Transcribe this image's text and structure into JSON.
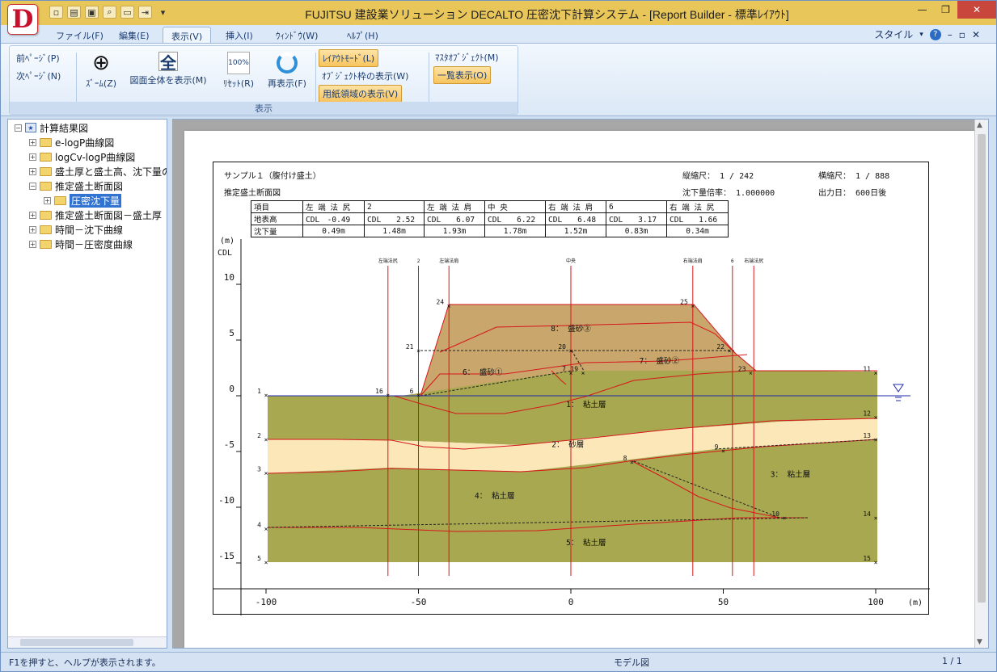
{
  "app": {
    "title": "FUJITSU 建設業ソリューション DECALTO 圧密沈下計算システム - [Report Builder - 標準ﾚｲｱｳﾄ]",
    "logo_letter": "D"
  },
  "quick_access": [
    "new-icon",
    "open-icon",
    "save-icon",
    "print-preview-icon",
    "print-icon",
    "export-icon"
  ],
  "window_controls": {
    "minimize": "—",
    "restore": "❐",
    "close": "✕"
  },
  "ribbon_tabs": [
    {
      "label": "ファイル(F)",
      "active": false
    },
    {
      "label": "編集(E)",
      "active": false
    },
    {
      "label": "表示(V)",
      "active": true
    },
    {
      "label": "挿入(I)",
      "active": false
    },
    {
      "label": "ｳｨﾝﾄﾞｳ(W)",
      "active": false
    },
    {
      "label": "ﾍﾙﾌﾟ(H)",
      "active": false
    }
  ],
  "ribbon_right": {
    "style_label": "スタイル",
    "dropdown": "▾",
    "help": "?",
    "mdi_min": "–",
    "mdi_restore": "▫",
    "mdi_close": "✕"
  },
  "ribbon": {
    "group_label": "表示",
    "prev_page": "前ﾍﾟｰｼﾞ(P)",
    "next_page": "次ﾍﾟｰｼﾞ(N)",
    "zoom": "ｽﾞｰﾑ(Z)",
    "fit_all": "図面全体を表示(M)",
    "fit_all_icon_text": "全",
    "reset": "ﾘｾｯﾄ(R)",
    "reset_icon_text": "100%",
    "redraw": "再表示(F)",
    "layout_mode": "ﾚｲｱｳﾄﾓｰﾄﾞ(L)",
    "object_frame": "ｵﾌﾞｼﾞｪｸﾄ枠の表示(W)",
    "paper_area": "用紙領域の表示(V)",
    "master_object": "ﾏｽﾀｵﾌﾞｼﾞｪｸﾄ(M)",
    "list_view": "一覧表示(O)"
  },
  "tree": {
    "root": "計算結果図",
    "items": [
      {
        "label": "e-logP曲線図",
        "level": 1,
        "expanded": false
      },
      {
        "label": "logCv-logP曲線図",
        "level": 1,
        "expanded": false
      },
      {
        "label": "盛土厚と盛土高、沈下量の",
        "level": 1,
        "expanded": false
      },
      {
        "label": "推定盛土断面図",
        "level": 1,
        "expanded": true
      },
      {
        "label": "圧密沈下量",
        "level": 2,
        "selected": true
      },
      {
        "label": "推定盛土断面図－盛土厚",
        "level": 1,
        "expanded": false
      },
      {
        "label": "時間－沈下曲線",
        "level": 1,
        "expanded": false
      },
      {
        "label": "時間－圧密度曲線",
        "level": 1,
        "expanded": false
      }
    ]
  },
  "report": {
    "title": "サンプル１（腹付け盛土）",
    "subtitle": "推定盛土断面図",
    "v_scale": "縦縮尺： 1 / 242",
    "h_scale": "横縮尺： 1 / 888",
    "settle_factor": "沈下量倍率： 1.000000",
    "output_day": "出力日： 600日後",
    "table_header": [
      "項目",
      "左 端 法 尻",
      "2",
      "左 端 法 肩",
      "中 央",
      "右 端 法 肩",
      "6",
      "右 端 法 尻"
    ],
    "table_row1": [
      "地表高",
      "CDL　-0.49",
      "CDL　　2.52",
      "CDL　　6.07",
      "CDL　　6.22",
      "CDL　　6.48",
      "CDL　　3.17",
      "CDL　　1.66"
    ],
    "table_row2": [
      "沈下量",
      "0.49m",
      "1.48m",
      "1.93m",
      "1.78m",
      "1.52m",
      "0.83m",
      "0.34m"
    ],
    "y_unit": "(m)",
    "y_datum": "CDL",
    "x_unit": "(m)"
  },
  "chart_data": {
    "type": "diagram",
    "x_ticks": [
      -100,
      -50,
      0,
      50,
      100
    ],
    "y_ticks": [
      10,
      5,
      0,
      -5,
      -10,
      -15
    ],
    "section_lines": [
      {
        "x": -60,
        "label": "左端法尻"
      },
      {
        "x": -50,
        "label": "2"
      },
      {
        "x": -40,
        "label": "左端法肩"
      },
      {
        "x": 0,
        "label": "中央"
      },
      {
        "x": 40,
        "label": "右端法肩"
      },
      {
        "x": 53,
        "label": "6"
      },
      {
        "x": 60,
        "label": "右端法尻"
      }
    ],
    "layer_labels": [
      {
        "label": "1： 粘土層",
        "x": 5,
        "y": -1
      },
      {
        "label": "2： 砂層",
        "x": -1,
        "y": -4.6
      },
      {
        "label": "3： 粘土層",
        "x": 72,
        "y": -7.3
      },
      {
        "label": "4： 粘土層",
        "x": -25,
        "y": -9.2
      },
      {
        "label": "5： 粘土層",
        "x": 5,
        "y": -13.4
      },
      {
        "label": "6： 盛砂①",
        "x": -29,
        "y": 1.9
      },
      {
        "label": "7： 盛砂②",
        "x": 29,
        "y": 2.9
      },
      {
        "label": "8： 盛砂③",
        "x": 0,
        "y": 5.8
      }
    ],
    "node_labels": [
      {
        "n": "1",
        "x": -100,
        "y": 0
      },
      {
        "n": "2",
        "x": -100,
        "y": -4
      },
      {
        "n": "3",
        "x": -100,
        "y": -7
      },
      {
        "n": "4",
        "x": -100,
        "y": -12
      },
      {
        "n": "5",
        "x": -100,
        "y": -15
      },
      {
        "n": "6",
        "x": -50,
        "y": 0
      },
      {
        "n": "7",
        "x": 0,
        "y": 2
      },
      {
        "n": "8",
        "x": 20,
        "y": -6
      },
      {
        "n": "9",
        "x": 50,
        "y": -5
      },
      {
        "n": "10",
        "x": 70,
        "y": -11
      },
      {
        "n": "11",
        "x": 100,
        "y": 2
      },
      {
        "n": "12",
        "x": 100,
        "y": -2
      },
      {
        "n": "13",
        "x": 100,
        "y": -4
      },
      {
        "n": "14",
        "x": 100,
        "y": -11
      },
      {
        "n": "15",
        "x": 100,
        "y": -15
      },
      {
        "n": "16",
        "x": -60,
        "y": 0
      },
      {
        "n": "19",
        "x": 4,
        "y": 2
      },
      {
        "n": "20",
        "x": 0,
        "y": 4
      },
      {
        "n": "21",
        "x": -50,
        "y": 4
      },
      {
        "n": "22",
        "x": 52,
        "y": 4
      },
      {
        "n": "23",
        "x": 59,
        "y": 2
      },
      {
        "n": "24",
        "x": -40,
        "y": 8
      },
      {
        "n": "25",
        "x": 40,
        "y": 8
      }
    ]
  },
  "status": {
    "help": "F1を押すと、ヘルプが表示されます。",
    "mode": "モデル図",
    "page": "1 / 1"
  }
}
